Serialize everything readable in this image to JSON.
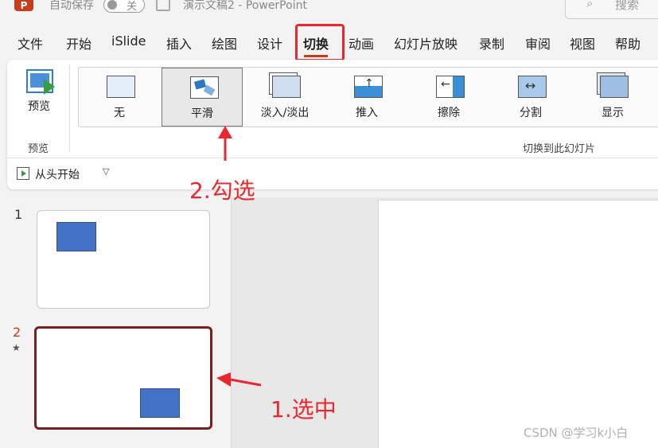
{
  "titlebar": {
    "app_logo": "P",
    "autosave_label": "自动保存",
    "autosave_toggle": "关",
    "document_title": "演示文稿2 - PowerPoint",
    "search_icon": "search-icon",
    "search_placeholder": "搜索"
  },
  "tabs": [
    "文件",
    "开始",
    "iSlide",
    "插入",
    "绘图",
    "设计",
    "切换",
    "动画",
    "幻灯片放映",
    "录制",
    "审阅",
    "视图",
    "帮助"
  ],
  "active_tab": "切换",
  "ribbon": {
    "preview_button": "预览",
    "preview_group_label": "预览",
    "transitions": [
      "无",
      "平滑",
      "淡入/淡出",
      "推入",
      "擦除",
      "分割",
      "显示"
    ],
    "selected_transition": "平滑",
    "transition_group_label": "切换到此幻灯片",
    "quick_access_label": "从头开始",
    "quick_access_caret": "▽"
  },
  "slides": [
    {
      "number": "1"
    },
    {
      "number": "2",
      "marker": "★"
    }
  ],
  "annotations": {
    "select_transition": "2.勾选",
    "select_slide": "1.选中"
  },
  "watermark": "CSDN @学习k小白",
  "colors": {
    "accent": "#c43e1c",
    "annotation_red": "#e8282e",
    "shape_fill": "#4472c4",
    "selected_slide_border": "#7a1f1f"
  }
}
